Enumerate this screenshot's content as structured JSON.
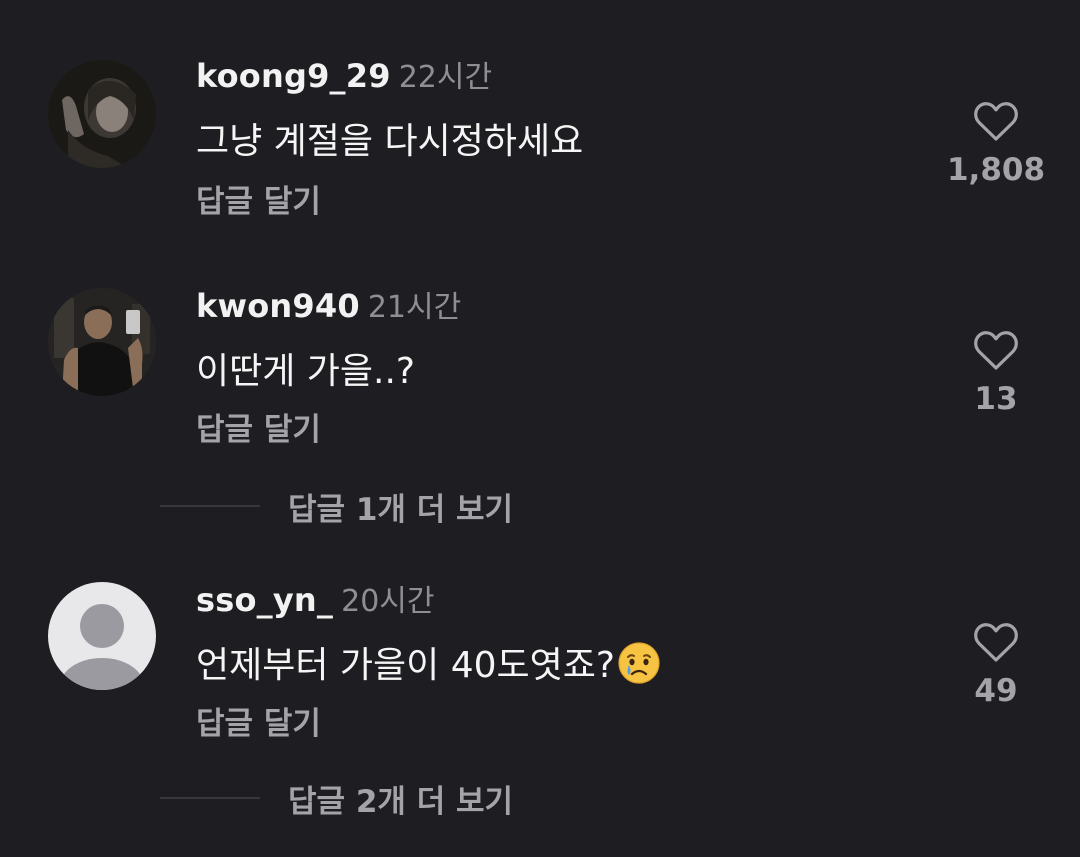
{
  "comments": [
    {
      "username": "koong9_29",
      "time": "22시간",
      "text": "그냥 계절을 다시정하세요",
      "reply_label": "답글 달기",
      "like_count": "1,808"
    },
    {
      "username": "kwon940",
      "time": "21시간",
      "text": "이딴게 가을..?",
      "reply_label": "답글 달기",
      "like_count": "13",
      "view_replies_label": "답글 1개 더 보기"
    },
    {
      "username": "sso_yn_",
      "time": "20시간",
      "text": "언제부터 가을이 40도엿죠?",
      "text_emoji": "crying-face-emoji",
      "reply_label": "답글 달기",
      "like_count": "49",
      "view_replies_label": "답글 2개 더 보기"
    }
  ],
  "colors": {
    "background": "#1e1e22",
    "secondary_text": "#a4a4a8",
    "timestamp": "#8e8e93"
  },
  "icons": {
    "like": "heart-outline-icon",
    "default_avatar": "default-avatar-icon"
  }
}
